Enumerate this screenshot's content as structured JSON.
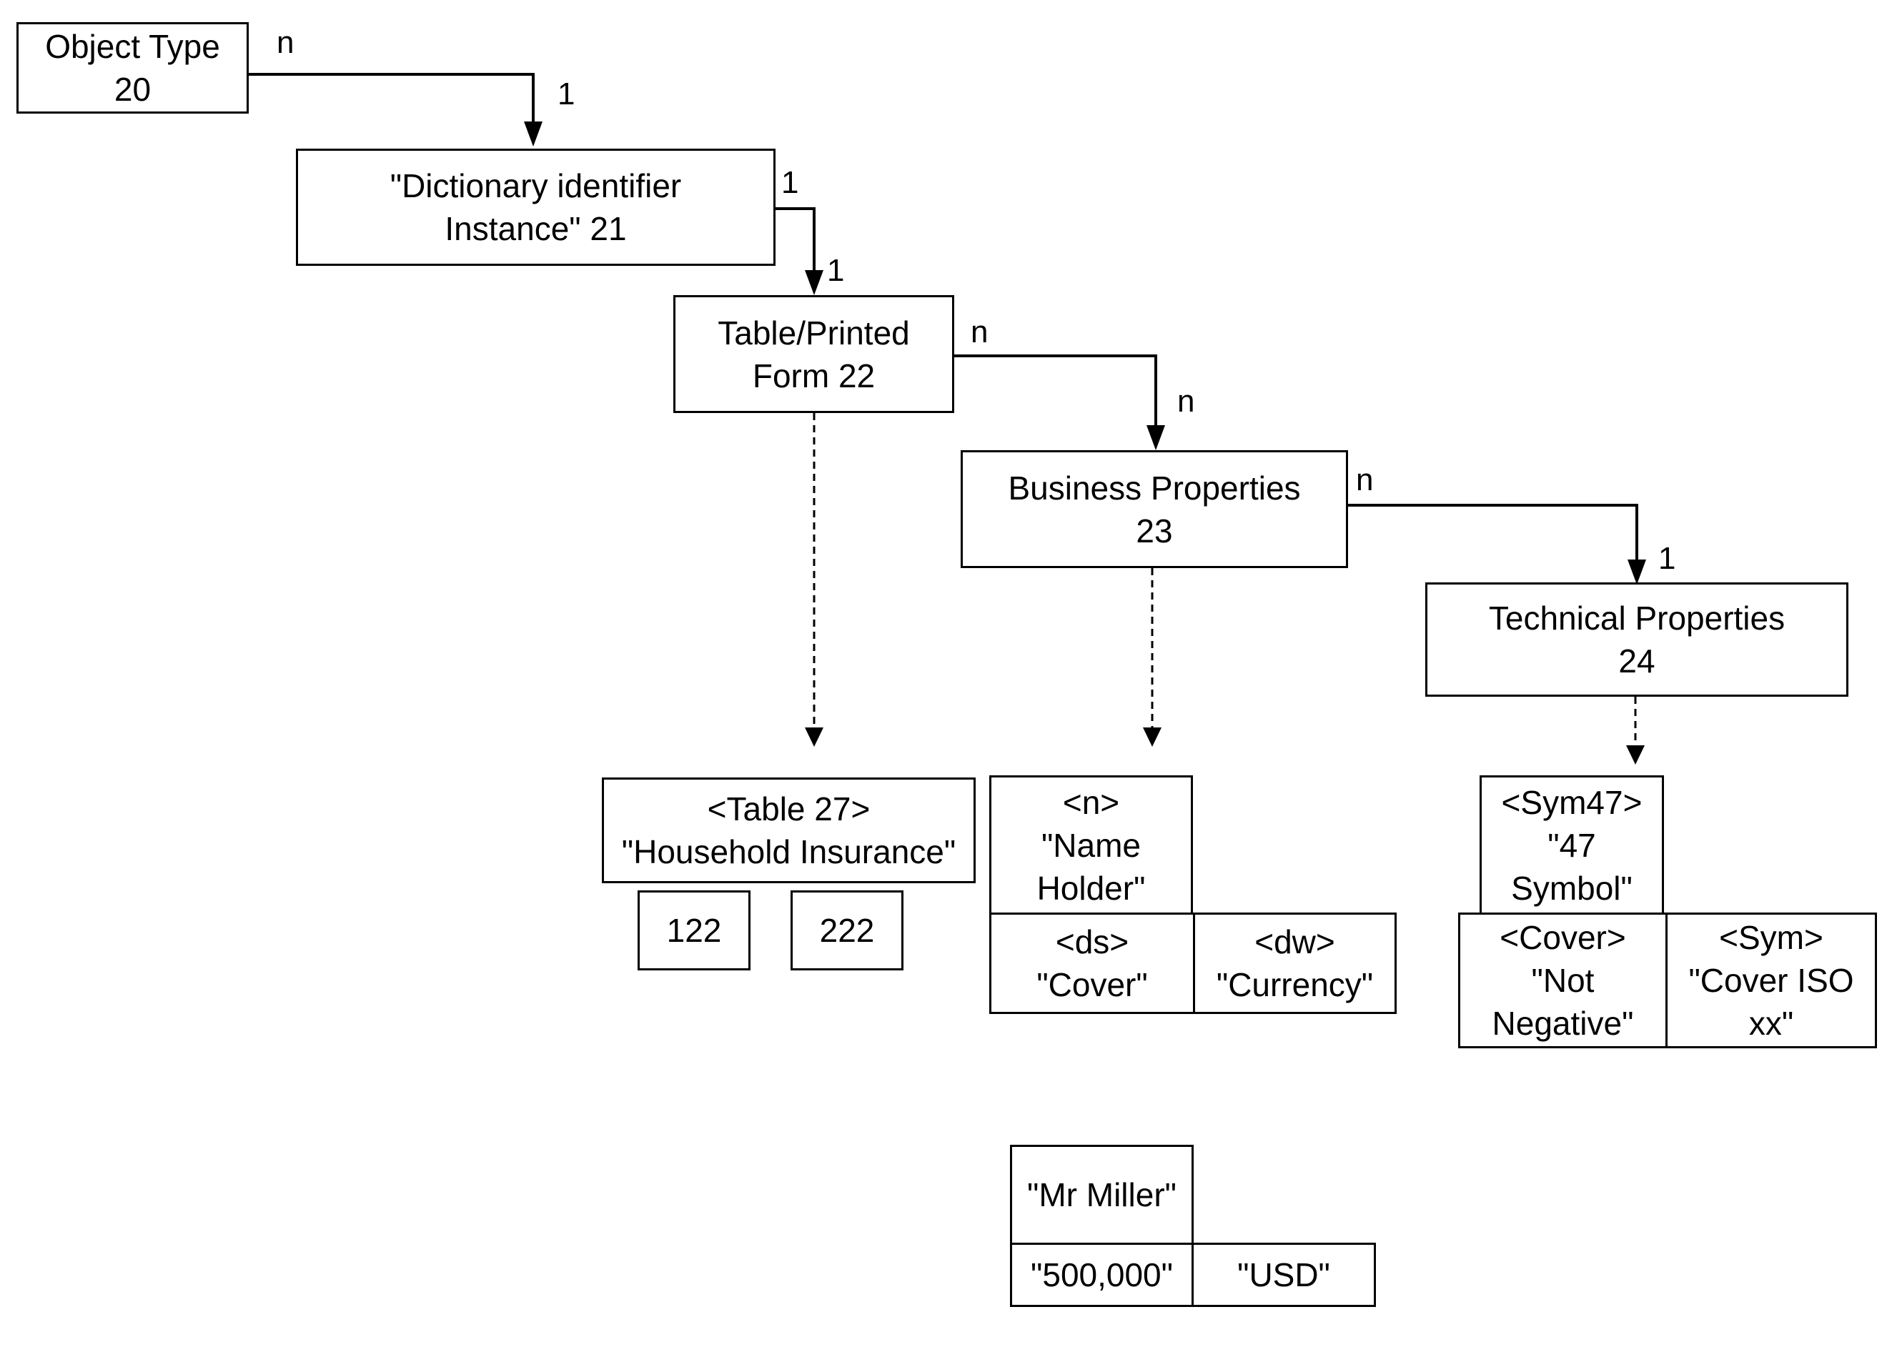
{
  "nodes": {
    "object_type": {
      "line1": "Object Type",
      "line2": "20"
    },
    "dictionary_instance": {
      "line1": "\"Dictionary identifier",
      "line2": "Instance\" 21"
    },
    "table_form": {
      "line1": "Table/Printed",
      "line2": "Form 22"
    },
    "business_props": {
      "line1": "Business Properties",
      "line2": "23"
    },
    "technical_props": {
      "line1": "Technical Properties",
      "line2": "24"
    }
  },
  "cardinalities": {
    "ot_src": "n",
    "ot_dst": "1",
    "di_src": "1",
    "di_dst": "1",
    "tf_src": "n",
    "tf_dst": "n",
    "bp_src": "n",
    "bp_dst": "1"
  },
  "table_example": {
    "header_line1": "<Table 27>",
    "header_line2": "\"Household Insurance\"",
    "cells": [
      "122",
      "222"
    ]
  },
  "business_example": {
    "n": {
      "tag": "<n>",
      "line1": "\"Name",
      "line2": "Holder\""
    },
    "ds": {
      "tag": "<ds>",
      "value": "\"Cover\""
    },
    "dw": {
      "tag": "<dw>",
      "value": "\"Currency\""
    }
  },
  "technical_example": {
    "sym47": {
      "tag": "<Sym47>",
      "line1": "\"47",
      "line2": "Symbol\""
    },
    "cover": {
      "tag": "<Cover>",
      "line1": "\"Not",
      "line2": "Negative\""
    },
    "sym": {
      "tag": "<Sym>",
      "line1": "\"Cover ISO",
      "line2": "xx\""
    }
  },
  "instance_values": {
    "name": "\"Mr Miller\"",
    "amount": "\"500,000\"",
    "currency": "\"USD\""
  }
}
